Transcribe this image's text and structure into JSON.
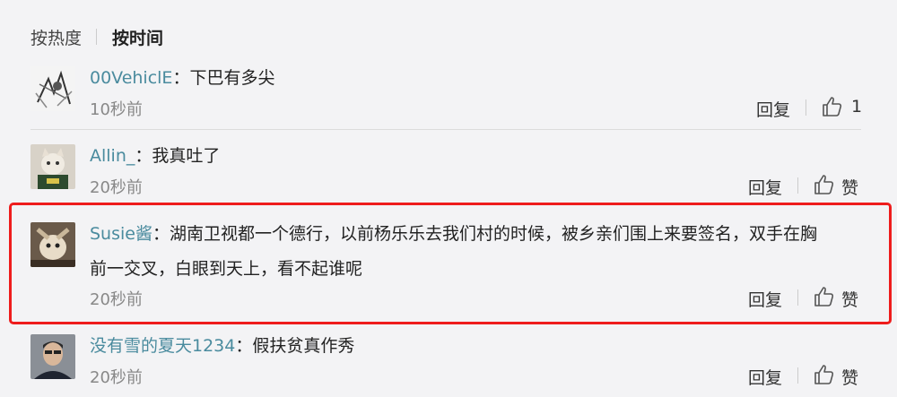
{
  "sort": {
    "hot_label": "按热度",
    "time_label": "按时间"
  },
  "comments": [
    {
      "user": "00VehiclE",
      "sep": "：",
      "text": "下巴有多尖",
      "text2": "",
      "time": "10秒前",
      "reply": "回复",
      "likes": "1"
    },
    {
      "user": "Allin_",
      "sep": "：",
      "text": "我真吐了",
      "text2": "",
      "time": "20秒前",
      "reply": "回复",
      "likes": "赞"
    },
    {
      "user": "Susie酱",
      "sep": "：",
      "text": "湖南卫视都一个德行，以前杨乐乐去我们村的时候，被乡亲们围上来要签名，双手在胸",
      "text2": "前一交叉，白眼到天上，看不起谁呢",
      "time": "20秒前",
      "reply": "回复",
      "likes": "赞"
    },
    {
      "user": "没有雪的夏天1234",
      "sep": "：",
      "text": "假扶贫真作秀",
      "text2": "",
      "time": "20秒前",
      "reply": "回复",
      "likes": "赞"
    }
  ],
  "colors": {
    "username": "#4a8b9e",
    "highlight": "#ee1c1c",
    "background": "#f3f3f5"
  }
}
